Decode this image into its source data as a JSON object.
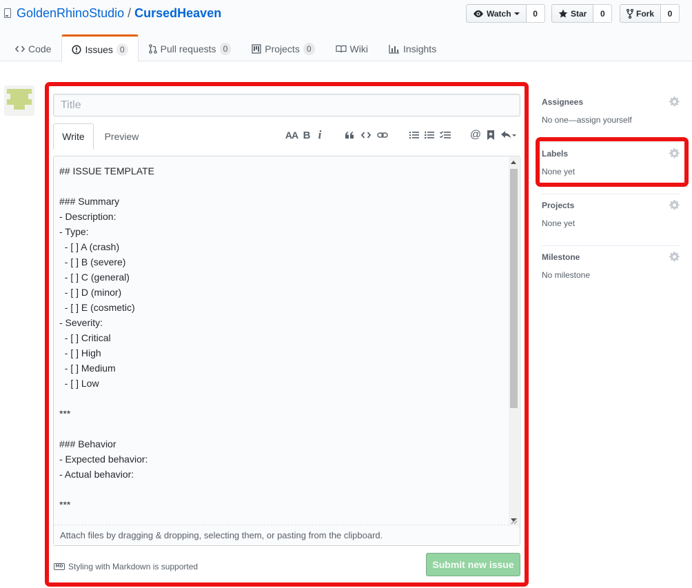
{
  "repo": {
    "owner": "GoldenRhinoStudio",
    "separator": "/",
    "name": "CursedHeaven"
  },
  "actions": {
    "watch": {
      "label": "Watch",
      "count": "0"
    },
    "star": {
      "label": "Star",
      "count": "0"
    },
    "fork": {
      "label": "Fork",
      "count": "0"
    }
  },
  "tabs": {
    "code": {
      "label": "Code"
    },
    "issues": {
      "label": "Issues",
      "count": "0"
    },
    "pulls": {
      "label": "Pull requests",
      "count": "0"
    },
    "projects": {
      "label": "Projects",
      "count": "0"
    },
    "wiki": {
      "label": "Wiki"
    },
    "insights": {
      "label": "Insights"
    }
  },
  "form": {
    "title_placeholder": "Title",
    "write_tab": "Write",
    "preview_tab": "Preview",
    "toolbar": {
      "header": "AA",
      "bold": "B",
      "italic": "i",
      "mention": "@"
    },
    "body": "## ISSUE TEMPLATE\n\n### Summary\n- Description:\n- Type:\n  - [ ] A (crash)\n  - [ ] B (severe)\n  - [ ] C (general)\n  - [ ] D (minor)\n  - [ ] E (cosmetic)\n- Severity:\n  - [ ] Critical\n  - [ ] High\n  - [ ] Medium\n  - [ ] Low\n\n***\n\n### Behavior\n- Expected behavior:\n- Actual behavior:\n\n***",
    "attach_hint": "Attach files by dragging & dropping, selecting them, or pasting from the clipboard.",
    "markdown_icon": "MD",
    "markdown_note": "Styling with Markdown is supported",
    "submit": "Submit new issue"
  },
  "sidebar": {
    "assignees": {
      "heading": "Assignees",
      "value": "No one—assign yourself"
    },
    "labels": {
      "heading": "Labels",
      "value": "None yet"
    },
    "projects": {
      "heading": "Projects",
      "value": "None yet"
    },
    "milestone": {
      "heading": "Milestone",
      "value": "No milestone"
    }
  },
  "colors": {
    "link": "#0366d6",
    "selected_tab_accent": "#e36209",
    "submit_disabled": "#94d3a2",
    "annotation": "#ee1111"
  },
  "icons": [
    "repo-icon",
    "eye-icon",
    "star-icon",
    "repo-forked-icon",
    "code-icon",
    "issue-opened-icon",
    "git-pull-request-icon",
    "project-icon",
    "book-icon",
    "graph-icon",
    "quote-icon",
    "link-icon",
    "list-unordered-icon",
    "list-ordered-icon",
    "tasklist-icon",
    "bookmark-icon",
    "reply-icon",
    "markdown-icon",
    "gear-icon"
  ]
}
